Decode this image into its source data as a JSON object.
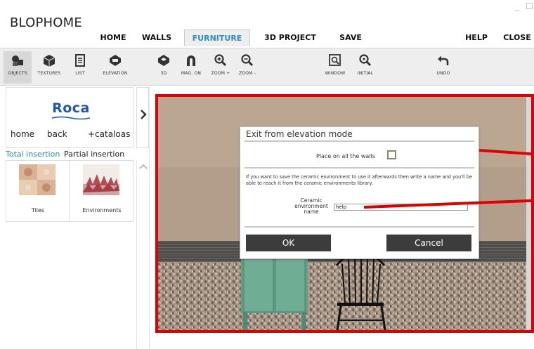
{
  "app": {
    "title": "BLOPHOME"
  },
  "window": {
    "minimize": "_",
    "maximize": "☐"
  },
  "menu": {
    "items": [
      {
        "label": "HOME",
        "active": false
      },
      {
        "label": "WALLS",
        "active": false
      },
      {
        "label": "FURNITURE",
        "active": true
      },
      {
        "label": "3D PROJECT",
        "active": false
      },
      {
        "label": "SAVE",
        "active": false
      },
      {
        "label": "HELP",
        "active": false
      },
      {
        "label": "CLOSE",
        "active": false
      }
    ]
  },
  "toolbar": {
    "tools": [
      {
        "label": "OBJECTS",
        "icon": "objects-icon",
        "active": true
      },
      {
        "label": "TEXTURES",
        "icon": "cube-icon"
      },
      {
        "label": "LIST",
        "icon": "list-icon"
      },
      {
        "label": "ELEVATION",
        "icon": "elevation-icon"
      },
      {
        "label": "3D",
        "icon": "3d-icon"
      },
      {
        "label": "MAG. ON",
        "icon": "magnet-icon"
      },
      {
        "label": "ZOOM +",
        "icon": "zoom-in-icon"
      },
      {
        "label": "ZOOM -",
        "icon": "zoom-out-icon"
      },
      {
        "label": "WINDOW",
        "icon": "zoom-window-icon"
      },
      {
        "label": "INITIAL",
        "icon": "zoom-initial-icon"
      },
      {
        "label": "UNDO",
        "icon": "undo-icon"
      }
    ]
  },
  "catalog": {
    "brand": "Roca",
    "links": {
      "home": "home",
      "back": "back",
      "catalogs": "+cataloas"
    },
    "next_icon": "chevron-right-icon"
  },
  "insertion_tabs": {
    "total": "Total insertion",
    "partial": "Partial insertion"
  },
  "thumbnails": [
    {
      "label": "Tiles"
    },
    {
      "label": "Environments"
    }
  ],
  "dialog": {
    "title": "Exit from elevation mode",
    "place_label": "Place on all the walls",
    "place_checked": false,
    "info_text": "If you want to save the ceramic environment to use it afterwards then write a name and you'll be able to reach it from the ceramic environments library.",
    "env_name_label": "Ceramic environment name",
    "env_name_value": "help",
    "ok_label": "OK",
    "cancel_label": "Cancel"
  },
  "colors": {
    "accent": "#2b8fcf",
    "highlight": "#e00000",
    "button_bg": "#3c3c3c",
    "chair_green": "#5f9f86",
    "wall_beige": "#b29e8a"
  }
}
